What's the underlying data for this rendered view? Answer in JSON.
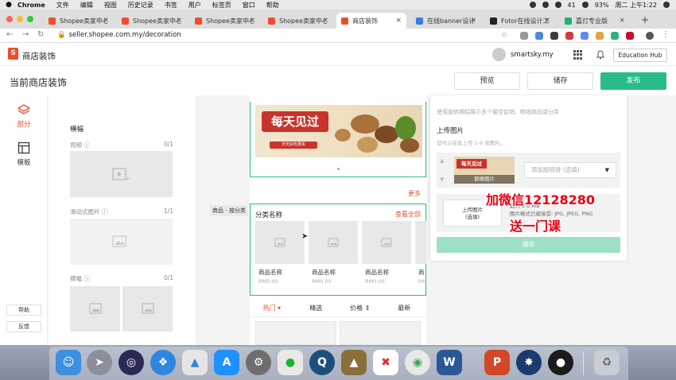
{
  "menubar": {
    "app": "Chrome",
    "items": [
      "文件",
      "编辑",
      "视图",
      "历史记录",
      "书签",
      "用户",
      "标签页",
      "窗口",
      "帮助"
    ],
    "status_number": "41",
    "battery": "93%",
    "clock": "周二 上午1:22"
  },
  "tabs": [
    {
      "title": "Shopee卖家中心",
      "color": "#ee4d2d"
    },
    {
      "title": "Shopee卖家中心",
      "color": "#ee4d2d"
    },
    {
      "title": "Shopee卖家中心",
      "color": "#ee4d2d"
    },
    {
      "title": "Shopee卖家中心",
      "color": "#ee4d2d"
    },
    {
      "title": "商店装饰",
      "color": "#ee4d2d"
    },
    {
      "title": "在线banner设计",
      "color": "#3b7ddd"
    },
    {
      "title": "Fotor在线设计工",
      "color": "#222222"
    },
    {
      "title": "嘉灯专业版",
      "color": "#1fb36a"
    }
  ],
  "addressbar": {
    "url": "seller.shopee.com.my/decoration"
  },
  "header": {
    "logo_letter": "S",
    "title": "商店装饰",
    "username": "smartsky.my",
    "education_hub": "Education Hub"
  },
  "titlebar": {
    "title": "当前商店装饰",
    "preview": "预览",
    "save": "储存",
    "publish": "发布"
  },
  "leftnav": {
    "section": "部分",
    "template": "模板",
    "help": "帮助",
    "feedback": "反馈"
  },
  "panel": {
    "heading": "横幅",
    "video_label": "视频",
    "video_count": "0/1",
    "carousel_label": "滑动式图片",
    "carousel_count": "1/1",
    "banner_label": "横幅",
    "banner_count": "0/1"
  },
  "canvas": {
    "banner_text": "每天见过",
    "banner_sub": "天天好吃果实",
    "more": "更多",
    "side_tag": "商品 - 按分类",
    "category_name": "分类名称",
    "view_all": "查看全部",
    "products": [
      {
        "name": "商品名称",
        "price": "RM0.00"
      },
      {
        "name": "商品名称",
        "price": "RM0.00"
      },
      {
        "name": "商品名称",
        "price": "RM0.00"
      },
      {
        "name": "商",
        "price": "RM"
      }
    ],
    "sort": {
      "hot": "热门",
      "best": "精选",
      "price": "价格",
      "newest": "最新"
    }
  },
  "settings": {
    "hint": "使用旋转横幅展示多个最佳促销、畅销商品或分类",
    "upload_heading": "上传图片",
    "upload_sub": "您可以在此上传 1-6 张图片。",
    "thumb_text": "每天见过",
    "replace_image": "替换图片",
    "link_placeholder": "添加超链接 (选填)",
    "upload_button_line1": "上传图片",
    "upload_button_line2": "(选填)",
    "upload_info_line1": "最大 2.0 MB",
    "upload_info_line2": "图片格式已被接受: JPG, JPEG, PNG",
    "save": "储存"
  },
  "watermark": {
    "line1": "加微信12128280",
    "line2": "送一门课",
    "color": "#e60012"
  },
  "colors": {
    "brand": "#ee4d2d",
    "accent": "#2abb8a"
  }
}
